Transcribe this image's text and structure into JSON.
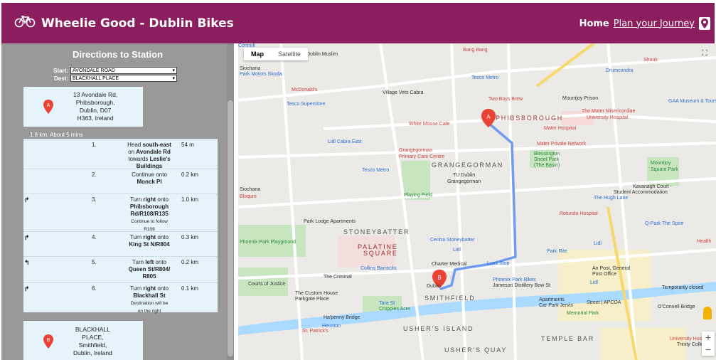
{
  "header": {
    "brand": "Wheelie Good - Dublin Bikes",
    "nav_home": "Home",
    "nav_plan": "Plan your Journey",
    "bg_color": "#8b1e5e"
  },
  "sidebar": {
    "title": "Directions to Station",
    "start_label": "Start:",
    "start_value": "AVONDALE ROAD",
    "dest_label": "Dest:",
    "dest_value": "BLACKHALL PLACE",
    "origin": {
      "marker": "A",
      "lines": [
        "13 Avondale Rd,",
        "Phibsborough,",
        "Dublin, D07",
        "H363, Ireland"
      ]
    },
    "summary": "1.8 km. About 5 mins",
    "steps": [
      {
        "num": "1.",
        "arrow": "",
        "lines": [
          "Head <b>south-east</b>",
          "on <b>Avondale Rd</b>",
          "towards <b>Leslie's</b>",
          "<b>Buildings</b>"
        ],
        "dist": "54 m"
      },
      {
        "num": "2.",
        "arrow": "",
        "lines": [
          "Continue onto",
          "<b>Monck Pl</b>"
        ],
        "dist": "0.2 km"
      },
      {
        "num": "3.",
        "arrow": "↱",
        "lines": [
          "Turn <b>right</b> onto",
          "<b>Phibsborough</b>",
          "<b>Rd/R108/R135</b>",
          "<small>Continue to follow</small>",
          "<small>R108</small>"
        ],
        "dist": "1.0 km"
      },
      {
        "num": "4.",
        "arrow": "↱",
        "lines": [
          "Turn <b>right</b> onto",
          "<b>King St N/R804</b>"
        ],
        "dist": "0.3 km"
      },
      {
        "num": "5.",
        "arrow": "↰",
        "lines": [
          "Turn <b>left</b> onto",
          "<b>Queen St/R804/</b>",
          "<b>R805</b>"
        ],
        "dist": "0.2 km"
      },
      {
        "num": "6.",
        "arrow": "↱",
        "lines": [
          "Turn <b>right</b> onto",
          "<b>Blackhall St</b>",
          "<small>Destination will be</small>",
          "<small>on the right</small>"
        ],
        "dist": "0.1 km"
      }
    ],
    "destination": {
      "marker": "B",
      "lines": [
        "BLACKHALL",
        "PLACE,",
        "Smithfield,",
        "Dublin, Ireland"
      ]
    }
  },
  "map": {
    "map_button": "Map",
    "satellite_button": "Satellite",
    "zoom_in": "+",
    "zoom_out": "−",
    "labels": [
      {
        "t": "Bang Bang",
        "c": "lbl-red"
      },
      {
        "t": "Dublin Muslim",
        "c": ""
      },
      {
        "t": "Tesco Metro",
        "c": "lbl-blue"
      },
      {
        "t": "Drumcondra",
        "c": "lbl-blue"
      },
      {
        "t": "Shouk",
        "c": "lbl-red"
      },
      {
        "t": "Park Motors Skoda",
        "c": "lbl-blue"
      },
      {
        "t": "McDonald's",
        "c": "lbl-red"
      },
      {
        "t": "Village Vets Cabra",
        "c": ""
      },
      {
        "t": "Two Boys Brew",
        "c": "lbl-red"
      },
      {
        "t": "Mountjoy Prison",
        "c": ""
      },
      {
        "t": "GAA Museum & Tours",
        "c": "lbl-blue"
      },
      {
        "t": "Tesco Superstore",
        "c": "lbl-blue"
      },
      {
        "t": "White Moose Cafe",
        "c": "lbl-red"
      },
      {
        "t": "The Mater Misericordiae",
        "c": "lbl-red"
      },
      {
        "t": "University Hospital",
        "c": "lbl-red"
      },
      {
        "t": "Mater Hospital",
        "c": "lbl-red"
      },
      {
        "t": "Lidl Cabra East",
        "c": "lbl-blue"
      },
      {
        "t": "Mater Private Network",
        "c": "lbl-red"
      },
      {
        "t": "Grangegorman",
        "c": "lbl-red"
      },
      {
        "t": "Primary Care Centre",
        "c": "lbl-red"
      },
      {
        "t": "Blessington",
        "c": "lbl-green"
      },
      {
        "t": "Street Park",
        "c": "lbl-green"
      },
      {
        "t": "(The Basin)",
        "c": "lbl-green"
      },
      {
        "t": "Tesco Metro",
        "c": "lbl-blue"
      },
      {
        "t": "TU Dublin",
        "c": ""
      },
      {
        "t": "Grangegorman",
        "c": ""
      },
      {
        "t": "Mountjoy",
        "c": "lbl-green"
      },
      {
        "t": "Square Park",
        "c": "lbl-green"
      },
      {
        "t": "Kavanagh Court -",
        "c": ""
      },
      {
        "t": "Student Accommodation",
        "c": ""
      },
      {
        "t": "Siochana",
        "c": ""
      },
      {
        "t": "Playing Field",
        "c": "lbl-green"
      },
      {
        "t": "The Hugh Lane",
        "c": "lbl-blue"
      },
      {
        "t": "Rotunda Hospital",
        "c": "lbl-red"
      },
      {
        "t": "Park Lodge Apartments",
        "c": ""
      },
      {
        "t": "Q-Park The Spire",
        "c": "lbl-blue"
      },
      {
        "t": "Centra Stoneybatter",
        "c": "lbl-blue"
      },
      {
        "t": "Lidl",
        "c": "lbl-blue"
      },
      {
        "t": "Lidl",
        "c": "lbl-blue"
      },
      {
        "t": "Phoenix Park Playground",
        "c": "lbl-green"
      },
      {
        "t": "Lidl",
        "c": "lbl-blue"
      },
      {
        "t": "Park Rite",
        "c": "lbl-blue"
      },
      {
        "t": "Collins Barracks",
        "c": "lbl-blue"
      },
      {
        "t": "Charter Medical",
        "c": ""
      },
      {
        "t": "Luas Stop",
        "c": "lbl-blue"
      },
      {
        "t": "An Post, General",
        "c": ""
      },
      {
        "t": "Post Office",
        "c": ""
      },
      {
        "t": "The Criminal",
        "c": ""
      },
      {
        "t": "Courts of Justice",
        "c": ""
      },
      {
        "t": "Phoenix Park Bikes",
        "c": "lbl-blue"
      },
      {
        "t": "Jameson Distillery Bow St",
        "c": ""
      },
      {
        "t": "Temporarily closed",
        "c": ""
      },
      {
        "t": "The Custom House",
        "c": ""
      },
      {
        "t": "Parkgate Place",
        "c": ""
      },
      {
        "t": "Apartments",
        "c": ""
      },
      {
        "t": "Car Park Jervis",
        "c": ""
      },
      {
        "t": "Street | APCOA",
        "c": ""
      },
      {
        "t": "O'Connell Bridge",
        "c": ""
      },
      {
        "t": "Tara St",
        "c": "lbl-blue"
      },
      {
        "t": "Croppies Acre",
        "c": "lbl-green"
      },
      {
        "t": "Memorial Park",
        "c": "lbl-green"
      },
      {
        "t": "Ha'penny Bridge",
        "c": ""
      },
      {
        "t": "Heuston",
        "c": "lbl-blue"
      },
      {
        "t": "St. Patrick's",
        "c": "lbl-red"
      },
      {
        "t": "University Hospital",
        "c": "lbl-red"
      },
      {
        "t": "Trinity College",
        "c": ""
      },
      {
        "t": "Dublin",
        "c": ""
      },
      {
        "t": "Bloqum",
        "c": "lbl-red"
      },
      {
        "t": "Siochana",
        "c": ""
      },
      {
        "t": "Health",
        "c": "lbl-red"
      },
      {
        "t": "Connoll",
        "c": "lbl-blue"
      }
    ],
    "areas": [
      {
        "t": "PHIBSBOROUGH",
        "c": "lbl-area-red"
      },
      {
        "t": "GRANGEGORMAN",
        "c": "lbl-area"
      },
      {
        "t": "STONEYBATTER",
        "c": "lbl-area"
      },
      {
        "t": "PALATINE",
        "c": "lbl-area-red"
      },
      {
        "t": "SQUARE",
        "c": "lbl-area-red"
      },
      {
        "t": "SMITHFIELD",
        "c": "lbl-area"
      },
      {
        "t": "USHER'S ISLAND",
        "c": "lbl-area"
      },
      {
        "t": "TEMPLE BAR",
        "c": "lbl-area"
      },
      {
        "t": "USHER'S QUAY",
        "c": "lbl-area"
      }
    ],
    "route_color": "#6f9cf0",
    "marker_color": "#ea4335"
  }
}
